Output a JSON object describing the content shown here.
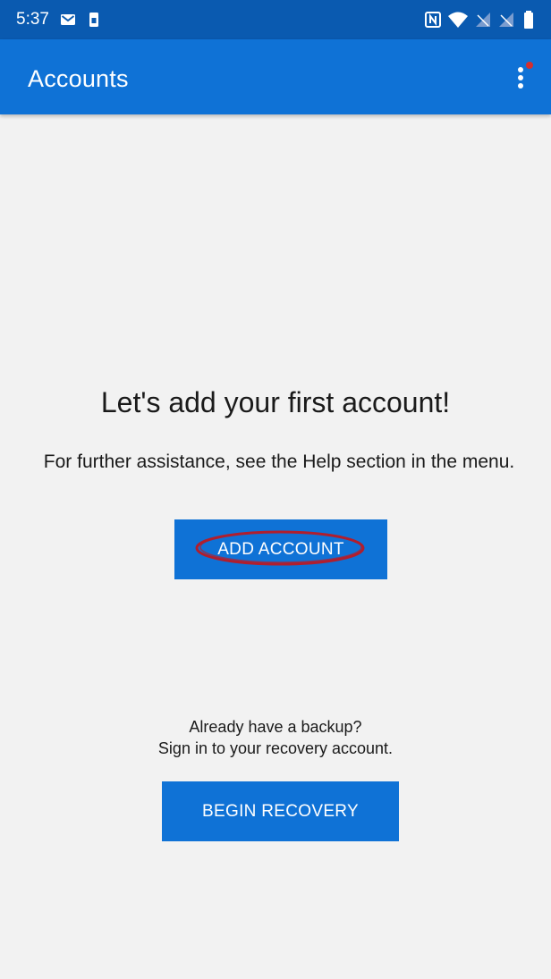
{
  "status_bar": {
    "time": "5:37",
    "icons": [
      "gmail-icon",
      "sim-icon",
      "nfc-icon",
      "wifi-icon",
      "signal-off-icon",
      "signal-off-icon",
      "battery-icon"
    ]
  },
  "app_bar": {
    "title": "Accounts",
    "menu_icon": "more-vert-icon",
    "notification_dot_color": "#d32f2f"
  },
  "main": {
    "headline": "Let's add your first account!",
    "help_text": "For further assistance, see the Help section in the menu.",
    "add_account_label": "ADD ACCOUNT",
    "backup_line1": "Already have a backup?",
    "backup_line2": "Sign in to your recovery account.",
    "begin_recovery_label": "BEGIN RECOVERY"
  },
  "colors": {
    "status_bar": "#0a5ab0",
    "app_bar": "#0f72d6",
    "button": "#0f72d6",
    "background": "#f2f2f2",
    "annotation": "#b01e2e"
  }
}
